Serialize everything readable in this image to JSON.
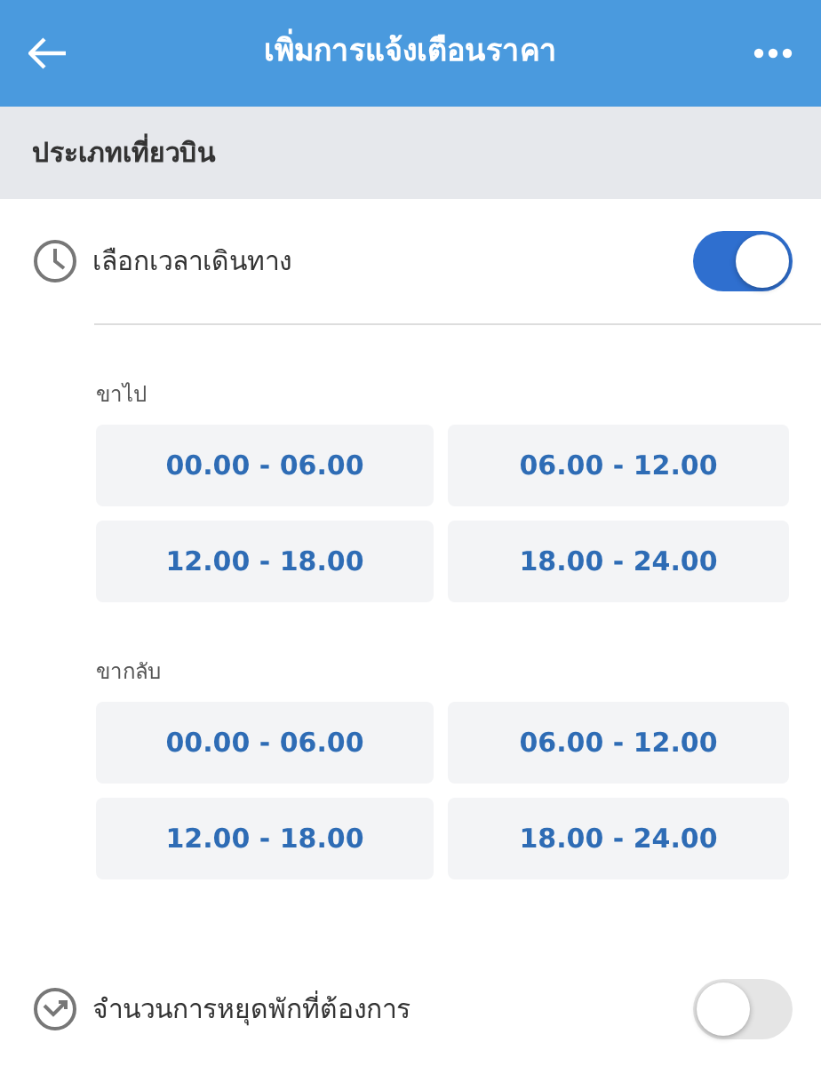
{
  "header": {
    "title": "เพิ่มการแจ้งเตือนราคา"
  },
  "section": {
    "title": "ประเภทเที่ยวบิน"
  },
  "time_option": {
    "label": "เลือกเวลาเดินทาง",
    "on": true
  },
  "groups": [
    {
      "label": "ขาไป",
      "slots": [
        {
          "label": "00.00 - 06.00",
          "selected": false
        },
        {
          "label": "06.00 - 12.00",
          "selected": false
        },
        {
          "label": "12.00 - 18.00",
          "selected": false
        },
        {
          "label": "18.00 - 24.00",
          "selected": false
        }
      ]
    },
    {
      "label": "ขากลับ",
      "slots": [
        {
          "label": "00.00 - 06.00",
          "selected": false
        },
        {
          "label": "06.00 - 12.00",
          "selected": false
        },
        {
          "label": "12.00 - 18.00",
          "selected": false
        },
        {
          "label": "18.00 - 24.00",
          "selected": false
        }
      ]
    }
  ],
  "stops_option": {
    "label": "จำนวนการหยุดพักที่ต้องการ",
    "on": false
  }
}
